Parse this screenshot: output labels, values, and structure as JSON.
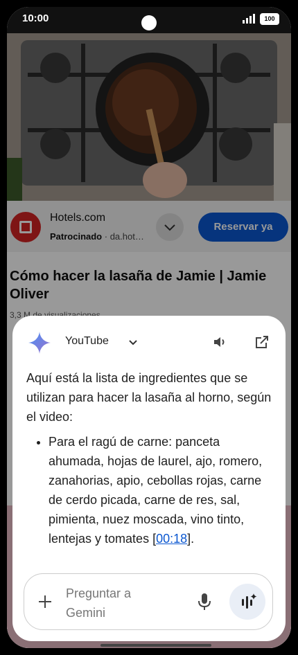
{
  "status_bar": {
    "time": "10:00",
    "battery": "100"
  },
  "ad": {
    "advertiser": "Hotels.com",
    "sponsored": "Patrocinado",
    "domain": "da.hot…",
    "cta": "Reservar ya"
  },
  "video": {
    "title": "Cómo hacer la lasaña de Jamie | Jamie Oliver",
    "meta": "3,3 M de visualizaciones"
  },
  "gemini": {
    "source_app": "YouTube",
    "intro": "Aquí está la lista de ingredientes que se utilizan para hacer la lasaña al horno, según el video:",
    "bullet_text": "Para el ragú de carne: panceta ahumada, hojas de laurel, ajo, romero, zanahorias, apio, cebollas rojas, carne de cerdo picada, carne de res, sal, pimienta, nuez moscada, vino tinto, lentejas y tomates ",
    "timestamp_link": "00:18",
    "bullet_end": ".",
    "input_placeholder": "Preguntar a Gemini"
  },
  "icons": [
    "gemini-star-icon",
    "chevron-down-icon",
    "speaker-icon",
    "open-external-icon",
    "plus-icon",
    "mic-icon",
    "gemini-live-icon",
    "signal-icon",
    "battery-icon"
  ],
  "colors": {
    "accent": "#0b57d0",
    "ad_logo": "#d32323"
  }
}
